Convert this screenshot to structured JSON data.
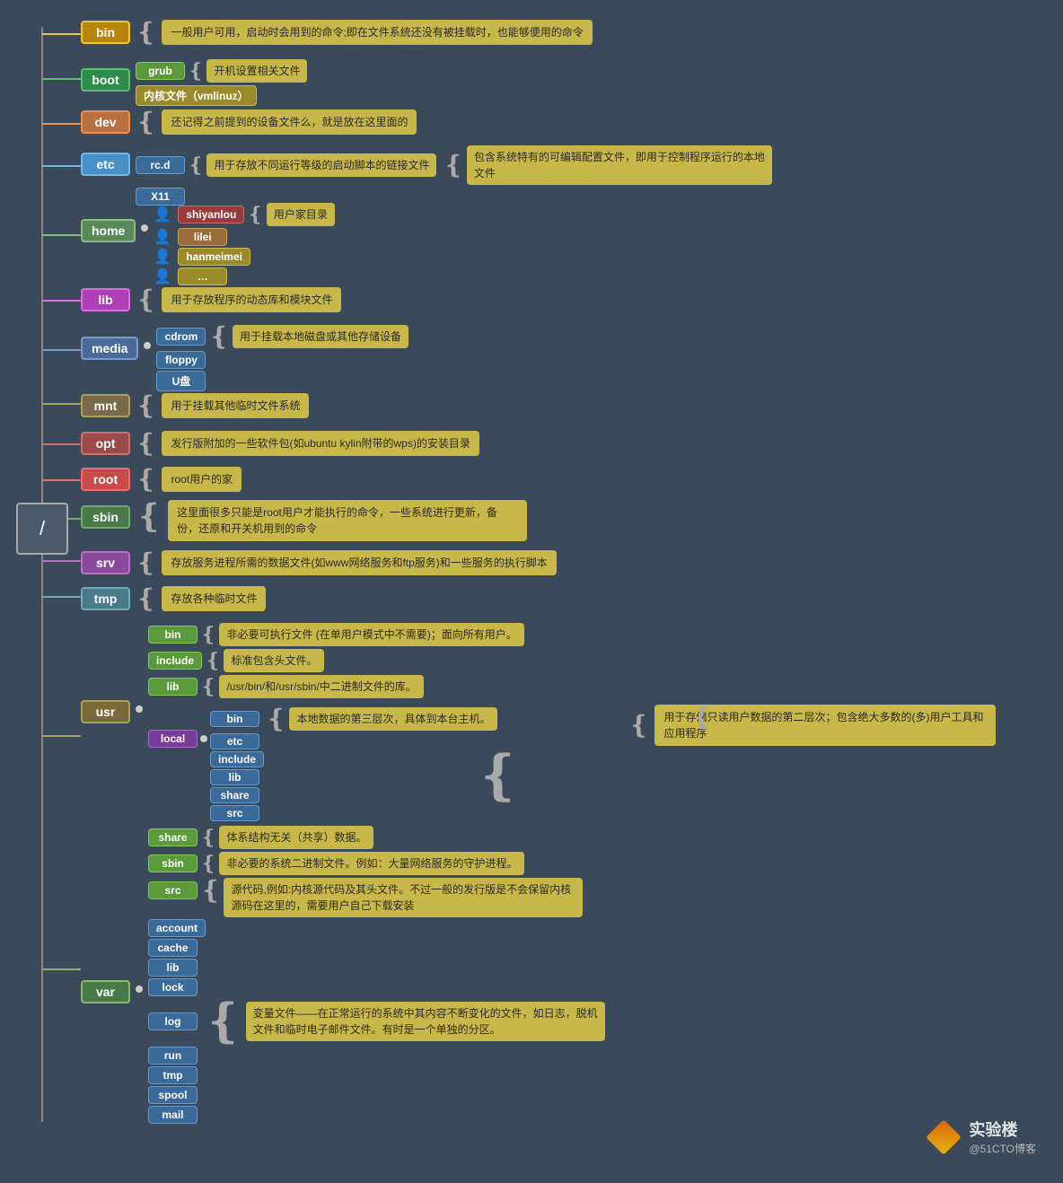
{
  "root": {
    "label": "/",
    "description": "用于存储只读用户数据的第二层次；包含绝大多数的(多)用户工具和应用程序"
  },
  "nodes": [
    {
      "id": "bin",
      "label": "bin",
      "color": "color-bin",
      "description": "一般用户可用，启动时会用到的命令;即在文件系统还没有被挂载时，也能够便用的命令",
      "children": []
    },
    {
      "id": "boot",
      "label": "boot",
      "color": "color-boot",
      "children": [
        {
          "label": "grub",
          "color": "color-sub-green"
        },
        {
          "label": "内核文件（vmlinuz）",
          "color": "color-sub-yellow"
        }
      ],
      "childDesc": "开机设置相关文件"
    },
    {
      "id": "dev",
      "label": "dev",
      "color": "color-dev",
      "description": "还记得之前提到的设备文件么，就是放在这里面的"
    },
    {
      "id": "etc",
      "label": "etc",
      "color": "color-etc",
      "children": [
        {
          "label": "rc.d",
          "color": "color-sub-blue"
        },
        {
          "label": "X11",
          "color": "color-sub-blue"
        }
      ],
      "childDesc": "用于存放不同运行等级的启动脚本的链接文件",
      "description": "包含系统特有的可编辑配置文件，即用于控制程序运行的本地文件"
    },
    {
      "id": "home",
      "label": "home",
      "color": "color-home",
      "users": [
        {
          "name": "shiyanlou",
          "iconColor": "user-red"
        },
        {
          "name": "lilei",
          "iconColor": "user-orange"
        },
        {
          "name": "hanmeimei",
          "iconColor": "user-yellow"
        },
        {
          "name": "…",
          "iconColor": "user-yellow"
        }
      ],
      "description": "用户家目录"
    },
    {
      "id": "lib",
      "label": "lib",
      "color": "color-lib",
      "description": "用于存放程序的动态库和模块文件"
    },
    {
      "id": "media",
      "label": "media",
      "color": "color-media",
      "children": [
        {
          "label": "cdrom",
          "color": "color-sub-blue"
        },
        {
          "label": "floppy",
          "color": "color-sub-blue"
        },
        {
          "label": "U盘",
          "color": "color-sub-blue"
        }
      ],
      "description": "用于挂载本地磁盘或其他存储设备"
    },
    {
      "id": "mnt",
      "label": "mnt",
      "color": "color-mnt",
      "description": "用于挂载其他临时文件系统"
    },
    {
      "id": "opt",
      "label": "opt",
      "color": "color-opt",
      "description": "发行版附加的一些软件包(如ubuntu kylin附带的wps)的安装目录"
    },
    {
      "id": "root",
      "label": "root",
      "color": "color-root",
      "description": "root用户的家"
    },
    {
      "id": "sbin",
      "label": "sbin",
      "color": "color-sbin",
      "description": "这里面很多只能是root用户才能执行的命令，一些系统进行更新，备份，还原和开关机用到的命令"
    },
    {
      "id": "srv",
      "label": "srv",
      "color": "color-srv",
      "description": "存放服务进程所需的数据文件(如www网络服务和ftp服务)和一些服务的执行脚本"
    },
    {
      "id": "tmp",
      "label": "tmp",
      "color": "color-tmp",
      "description": "存放各种临时文件"
    },
    {
      "id": "usr",
      "label": "usr",
      "color": "color-usr",
      "description": "用于存储只读用户数据的第二层次；包含绝大多数的(多)用户工具和应用程序",
      "subNodes": [
        {
          "label": "bin",
          "desc": "非必要可执行文件 (在单用户模式中不需要)；面向所有用户。"
        },
        {
          "label": "include",
          "desc": "标准包含头文件。"
        },
        {
          "label": "lib",
          "desc": "/usr/bin/和/usr/sbin/中二进制文件的库。"
        }
      ],
      "localNode": {
        "label": "local",
        "children": [
          "bin",
          "etc",
          "include",
          "lib",
          "share",
          "src"
        ],
        "desc": "本地数据的第三层次，具体到本台主机。"
      },
      "extraNodes": [
        {
          "label": "share",
          "desc": "体系结构无关（共享）数据。"
        },
        {
          "label": "sbin",
          "desc": "非必要的系统二进制文件。例如：大量网络服务的守护进程。"
        },
        {
          "label": "src",
          "desc": "源代码,例如:内核源代码及其头文件。不过一般的发行版是不会保留内核源码在这里的，需要用户自己下载安装"
        }
      ]
    },
    {
      "id": "var",
      "label": "var",
      "color": "color-var",
      "description": "变量文件——在正常运行的系统中其内容不断变化的文件，如日志，脱机文件和临时电子邮件文件。有时是一个单独的分区。",
      "children": [
        "account",
        "cache",
        "lib",
        "lock",
        "log",
        "run",
        "tmp",
        "spool",
        "mail"
      ]
    }
  ],
  "watermark": {
    "name": "实验楼",
    "sub": "@51CTO博客"
  }
}
